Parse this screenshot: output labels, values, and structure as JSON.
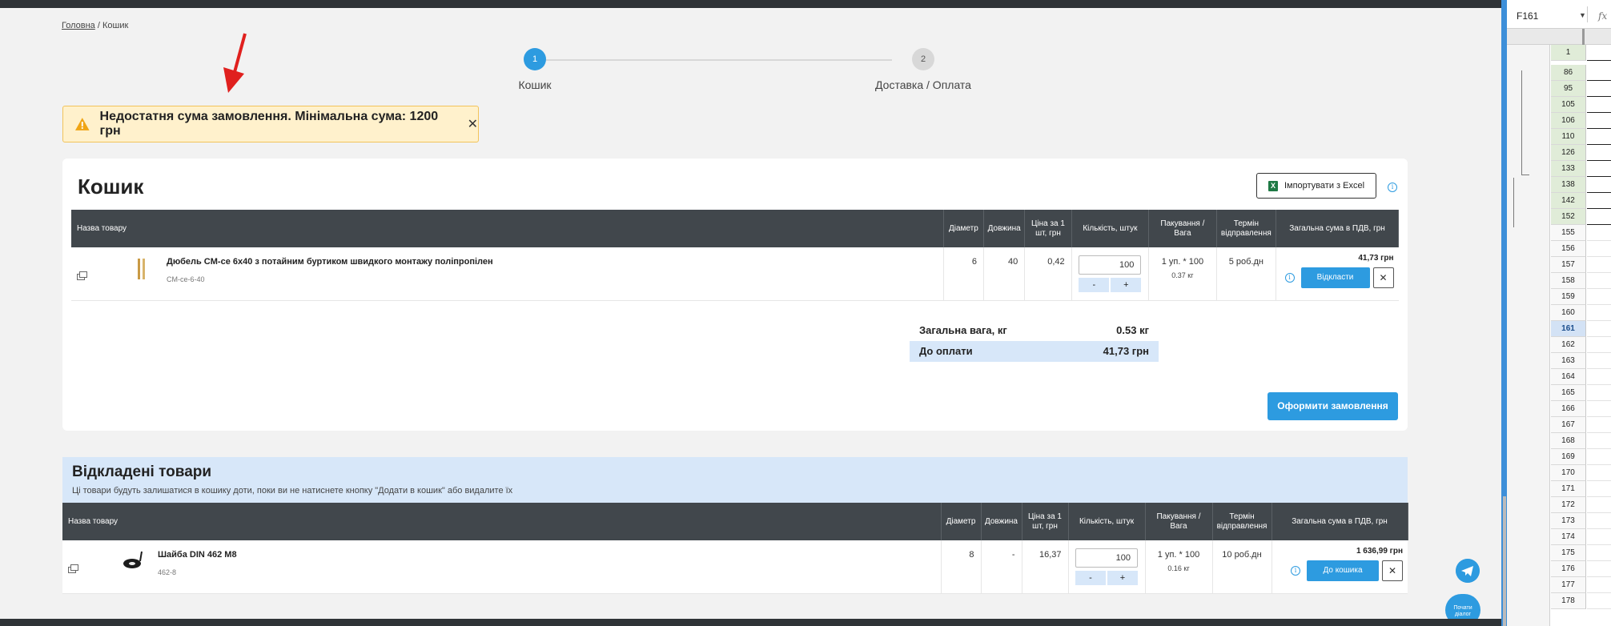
{
  "breadcrumb": {
    "home": "Головна",
    "separator": "/",
    "current": "Кошик"
  },
  "steps": [
    {
      "number": "1",
      "label": "Кошик",
      "active": true
    },
    {
      "number": "2",
      "label": "Доставка / Оплата",
      "active": false
    }
  ],
  "warning": {
    "icon": "warning-triangle-icon",
    "text": "Недостатня сума замовлення. Мінімальна сума: 1200 грн",
    "close": "✕"
  },
  "cart": {
    "title": "Кошик",
    "import_button": "Імпортувати з Excel",
    "columns": [
      "Назва товару",
      "Діаметр",
      "Довжина",
      "Ціна за 1 шт, грн",
      "Кількість, штук",
      "Пакування / Вага",
      "Термін відправлення",
      "Загальна сума в ПДВ, грн"
    ],
    "items": [
      {
        "name": "Дюбель CM-ce 6x40 з потайним буртиком швидкого монтажу поліпропілен",
        "sku": "CM-ce-6-40",
        "diameter": "6",
        "length": "40",
        "price": "0,42",
        "qty": "100",
        "minus": "-",
        "plus": "+",
        "pack": "1 уп. * 100",
        "weight": "0.37 кг",
        "ship": "5 роб.дн",
        "total": "41,73 грн",
        "action": "Відкласти",
        "remove": "✕"
      }
    ],
    "summary": {
      "weight_label": "Загальна вага, кг",
      "weight_value": "0.53 кг",
      "pay_label": "До оплати",
      "pay_value": "41,73 грн"
    },
    "order_button": "Оформити замовлення"
  },
  "deferred": {
    "title": "Відкладені товари",
    "subtitle": "Ці товари будуть залишатися в кошику доти, поки ви не натиснете кнопку \"Додати в кошик\" або видалите їх",
    "columns": [
      "Назва товару",
      "Діаметр",
      "Довжина",
      "Ціна за 1 шт, грн",
      "Кількість, штук",
      "Пакування / Вага",
      "Термін відправлення",
      "Загальна сума в ПДВ, грн"
    ],
    "items": [
      {
        "name": "Шайба DIN 462 M8",
        "sku": "462-8",
        "diameter": "8",
        "length": "-",
        "price": "16,37",
        "qty": "100",
        "minus": "-",
        "plus": "+",
        "pack": "1 уп. * 100",
        "weight": "0.16 кг",
        "ship": "10 роб.дн",
        "total": "1 636,99 грн",
        "action": "До кошика",
        "remove": "✕"
      }
    ]
  },
  "chat": {
    "label": "Почати діалог",
    "icon": "telegram-icon"
  },
  "sheet": {
    "name_box": "F161",
    "fx": "fx",
    "header_row": "1",
    "rows": [
      "86",
      "95",
      "105",
      "106",
      "110",
      "126",
      "133",
      "138",
      "142",
      "152",
      "155",
      "156",
      "157",
      "158",
      "159",
      "160",
      "161",
      "162",
      "163",
      "164",
      "165",
      "166",
      "167",
      "168",
      "169",
      "170",
      "171",
      "172",
      "173",
      "174",
      "175",
      "176",
      "177",
      "178"
    ],
    "selected_row": "161"
  },
  "colors": {
    "accent": "#2d9be0",
    "header": "#41474c",
    "warning_bg": "#fff1cc",
    "deferred_bg": "#d7e7f9",
    "annotation": "#e0201e"
  }
}
